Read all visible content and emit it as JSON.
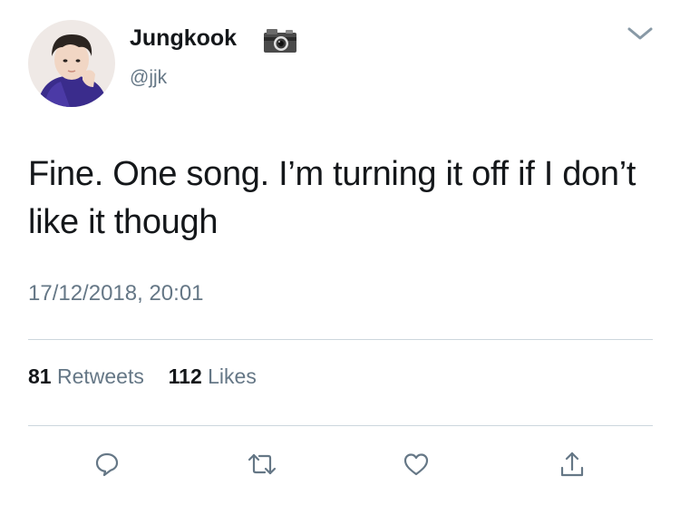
{
  "user": {
    "display_name": "Jungkook",
    "handle": "@jjk",
    "badge_icon": "camera-icon",
    "avatar_colors": {
      "hair": "#2b2420",
      "skin": "#f1d6c4",
      "jacket": "#3a2c8c",
      "background": "#efe9e6"
    }
  },
  "tweet": {
    "text": "Fine. One song. I’m turning it off if I don’t like it though",
    "timestamp": "17/12/2018, 20:01"
  },
  "stats": {
    "retweets_count": "81",
    "retweets_label": "Retweets",
    "likes_count": "112",
    "likes_label": "Likes"
  },
  "actions": {
    "icons": [
      "reply-icon",
      "retweet-icon",
      "like-icon",
      "share-icon"
    ],
    "menu_icon": "chevron-down-icon"
  },
  "colors": {
    "text_primary": "#14171a",
    "text_secondary": "#657786",
    "icon": "#657786",
    "divider": "#ccd6dd"
  }
}
